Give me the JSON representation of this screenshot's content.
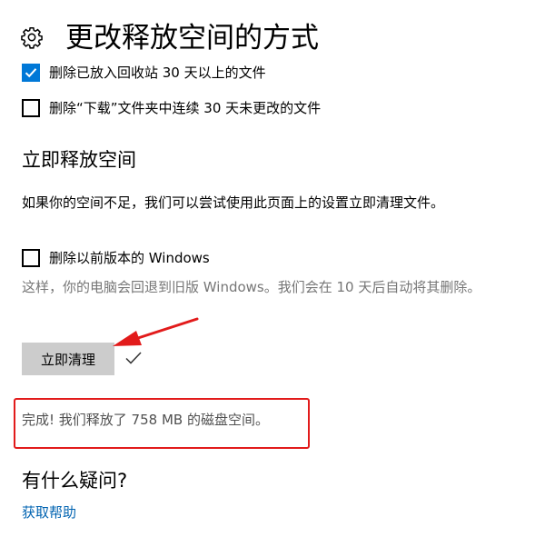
{
  "header": {
    "title": "更改释放空间的方式",
    "icon": "gear-icon"
  },
  "options": [
    {
      "label": "删除已放入回收站 30 天以上的文件",
      "checked": true
    },
    {
      "label": "删除“下载”文件夹中连续 30 天未更改的文件",
      "checked": false
    }
  ],
  "free_now": {
    "heading": "立即释放空间",
    "description": "如果你的空间不足，我们可以尝试使用此页面上的设置立即清理文件。",
    "option_label": "删除以前版本的 Windows",
    "option_checked": false,
    "option_note": "这样，你的电脑会回退到旧版 Windows。我们会在 10 天后自动将其删除。",
    "button_label": "立即清理",
    "done_icon": "checkmark-icon",
    "result": "完成! 我们释放了 758 MB 的磁盘空间。"
  },
  "help": {
    "heading": "有什么疑问?",
    "link_label": "获取帮助"
  },
  "colors": {
    "accent": "#0078d7",
    "button_bg": "#cccccc",
    "annotation_red": "#e21b1b",
    "link": "#0063b1",
    "secondary_text": "#767676"
  }
}
